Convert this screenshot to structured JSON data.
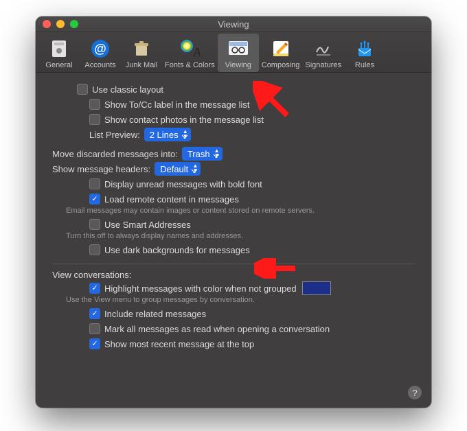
{
  "window": {
    "title": "Viewing"
  },
  "toolbar": {
    "items": [
      {
        "label": "General"
      },
      {
        "label": "Accounts"
      },
      {
        "label": "Junk Mail"
      },
      {
        "label": "Fonts & Colors"
      },
      {
        "label": "Viewing"
      },
      {
        "label": "Composing"
      },
      {
        "label": "Signatures"
      },
      {
        "label": "Rules"
      }
    ]
  },
  "opts": {
    "classic_layout": "Use classic layout",
    "show_tocc": "Show To/Cc label in the message list",
    "show_contact_photos": "Show contact photos in the message list",
    "list_preview_label": "List Preview:",
    "list_preview_value": "2 Lines",
    "move_discarded_label": "Move discarded messages into:",
    "move_discarded_value": "Trash",
    "show_headers_label": "Show message headers:",
    "show_headers_value": "Default",
    "display_bold": "Display unread messages with bold font",
    "load_remote": "Load remote content in messages",
    "load_remote_hint": "Email messages may contain images or content stored on remote servers.",
    "smart_addresses": "Use Smart Addresses",
    "smart_addresses_hint": "Turn this off to always display names and addresses.",
    "dark_backgrounds": "Use dark backgrounds for messages",
    "view_conversations_label": "View conversations:",
    "highlight_color": "Highlight messages with color when not grouped",
    "highlight_color_hint": "Use the View menu to group messages by conversation.",
    "include_related": "Include related messages",
    "mark_all_read": "Mark all messages as read when opening a conversation",
    "most_recent_top": "Show most recent message at the top"
  },
  "colors": {
    "highlight_swatch": "#1a2e8a"
  }
}
